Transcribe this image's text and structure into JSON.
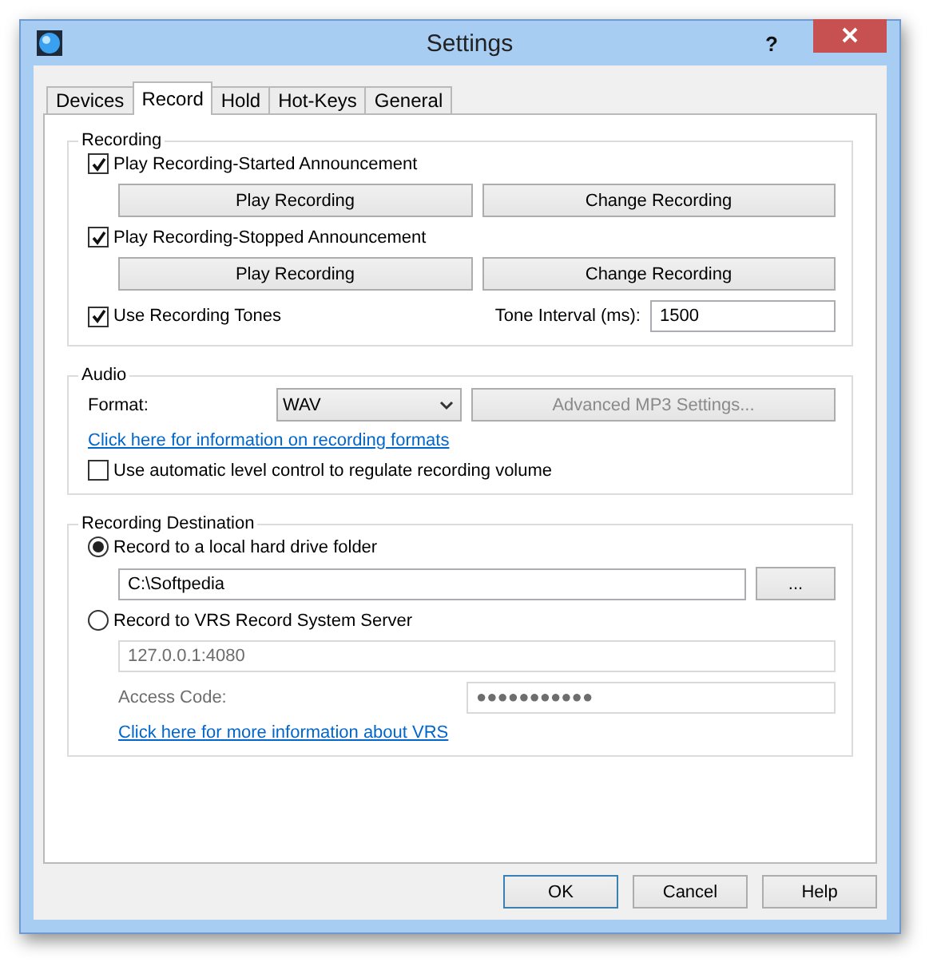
{
  "window": {
    "title": "Settings",
    "help": "?"
  },
  "tabs": [
    {
      "label": "Devices",
      "selected": false
    },
    {
      "label": "Record",
      "selected": true
    },
    {
      "label": "Hold",
      "selected": false
    },
    {
      "label": "Hot-Keys",
      "selected": false
    },
    {
      "label": "General",
      "selected": false
    }
  ],
  "recording": {
    "title": "Recording",
    "announcements": [
      {
        "label": "Play Recording-Started Announcement",
        "checked": true,
        "play": "Play Recording",
        "change": "Change Recording"
      },
      {
        "label": "Play Recording-Stopped Announcement",
        "checked": true,
        "play": "Play Recording",
        "change": "Change Recording"
      }
    ],
    "tones": {
      "label": "Use Recording Tones",
      "checked": true
    },
    "tone_interval": {
      "label": "Tone Interval (ms):",
      "value": "1500"
    }
  },
  "audio": {
    "title": "Audio",
    "format_label": "Format:",
    "format_value": "WAV",
    "advanced": {
      "label": "Advanced MP3 Settings...",
      "disabled": true
    },
    "link": "Click here for information on recording formats",
    "auto_level": {
      "label": "Use automatic level control to regulate recording volume",
      "checked": false
    }
  },
  "destination": {
    "title": "Recording Destination",
    "options": [
      {
        "label": "Record to a local hard drive folder",
        "selected": true
      },
      {
        "label": "Record to VRS Record System Server",
        "selected": false
      }
    ],
    "folder": "C:\\Softpedia",
    "browse": "...",
    "server": {
      "disabled": true,
      "address": "127.0.0.1:4080",
      "access_label": "Access Code:",
      "access_value": "●●●●●●●●●●●"
    },
    "link": "Click here for more information about VRS"
  },
  "buttons": [
    {
      "label": "OK",
      "default": true
    },
    {
      "label": "Cancel",
      "default": false
    },
    {
      "label": "Help",
      "default": false
    }
  ]
}
